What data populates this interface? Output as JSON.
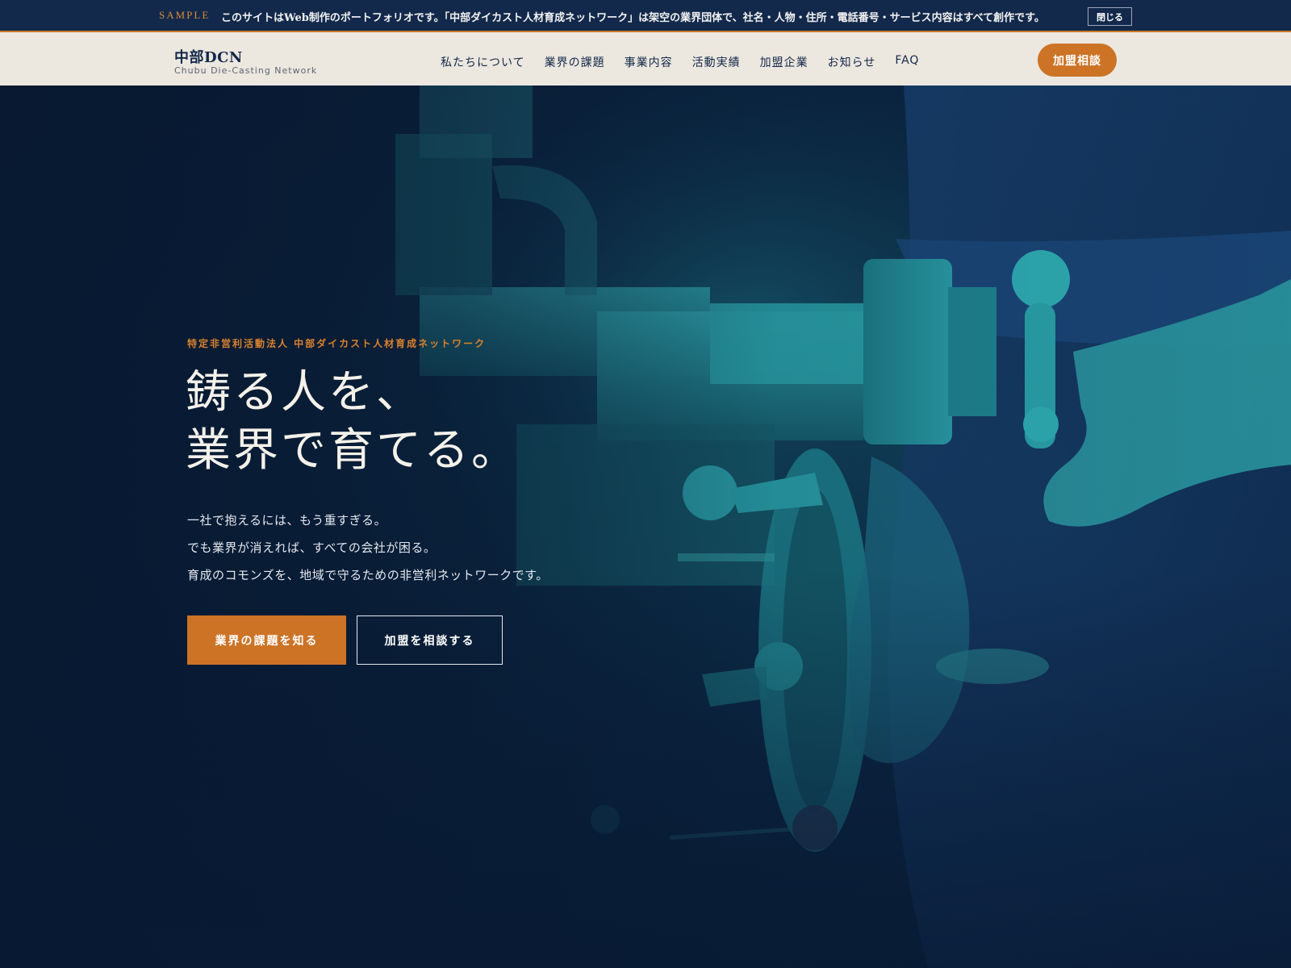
{
  "notice": {
    "tag": "SAMPLE",
    "text": "このサイトはWeb制作のポートフォリオです。「中部ダイカスト人材育成ネットワーク」は架空の業界団体で、社名・人物・住所・電話番号・サービス内容はすべて創作です。",
    "close_label": "閉じる"
  },
  "header": {
    "logo_main": "中部DCN",
    "logo_sub": "Chubu Die-Casting Network",
    "nav": [
      {
        "label": "私たちについて"
      },
      {
        "label": "業界の課題"
      },
      {
        "label": "事業内容"
      },
      {
        "label": "活動実績"
      },
      {
        "label": "加盟企業"
      },
      {
        "label": "お知らせ"
      },
      {
        "label": "FAQ"
      }
    ],
    "cta_label": "加盟相談"
  },
  "hero": {
    "eyebrow": "特定非営利活動法人 中部ダイカスト人材育成ネットワーク",
    "headline": [
      "鋳る人を、",
      "業界で育てる。"
    ],
    "lead": [
      "一社で抱えるには、もう重すぎる。",
      "でも業界が消えれば、すべての会社が困る。",
      "育成のコモンズを、地域で守るための非営利ネットワークです。"
    ],
    "primary_button": "業界の課題を知る",
    "secondary_button": "加盟を相談する",
    "image_subject": "industrial-machine-operator-photo"
  },
  "colors": {
    "navy": "#13294b",
    "accent_orange": "#cc7326",
    "header_bg": "#ece7df",
    "hero_teal": "#1e8c96"
  }
}
